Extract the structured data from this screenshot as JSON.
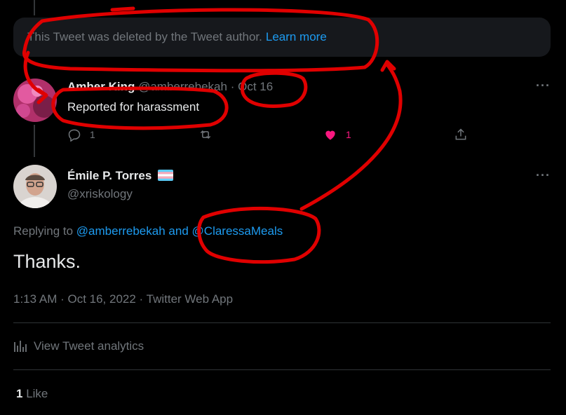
{
  "deleted": {
    "text": "This Tweet was deleted by the Tweet author.",
    "link": "Learn more"
  },
  "reply": {
    "name": "Amber King",
    "handle": "@amberrebekah",
    "sep": "·",
    "date": "Oct 16",
    "text": "Reported for harassment",
    "reply_count": "1",
    "like_count": "1",
    "colors": {
      "like": "#f91880"
    }
  },
  "main": {
    "name": "Émile P. Torres",
    "handle": "@xriskology",
    "replying_prefix": "Replying to",
    "replying_user1": "@amberrebekah",
    "replying_and": "and",
    "replying_user2": "@ClaressaMeals",
    "text": "Thanks.",
    "meta": "1:13 AM · Oct 16, 2022 · Twitter Web App",
    "analytics": "View Tweet analytics",
    "likes_count": "1",
    "likes_label": "Like"
  },
  "icons": [
    "more-icon",
    "reply-icon",
    "retweet-icon",
    "like-icon",
    "share-icon",
    "analytics-icon",
    "trans-flag-icon"
  ],
  "colors": {
    "background": "#000000",
    "accent": "#1d9bf0",
    "annotation": "#e00000"
  }
}
